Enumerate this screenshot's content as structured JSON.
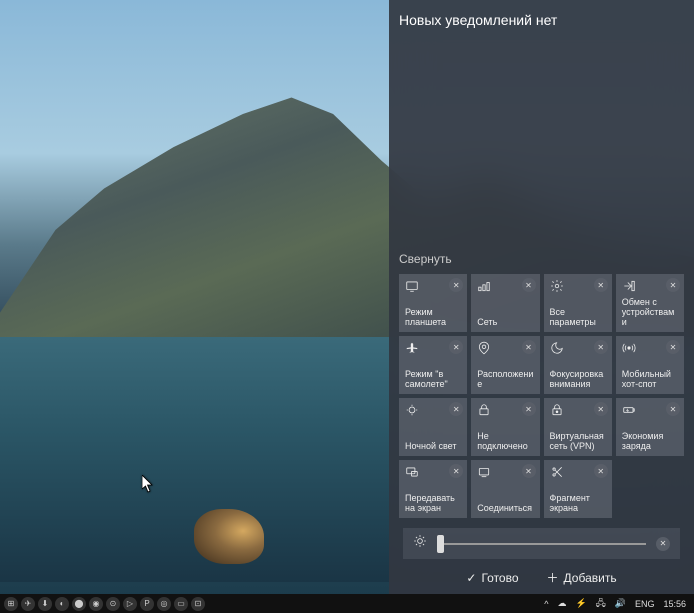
{
  "panel": {
    "title": "Новых уведомлений нет",
    "collapse": "Свернуть",
    "done": "Готово",
    "add": "Добавить"
  },
  "tiles": [
    {
      "icon": "tablet",
      "label": "Режим планшета"
    },
    {
      "icon": "network",
      "label": "Сеть"
    },
    {
      "icon": "settings",
      "label": "Все параметры"
    },
    {
      "icon": "share",
      "label": "Обмен с устройствами"
    },
    {
      "icon": "airplane",
      "label": "Режим \"в самолете\""
    },
    {
      "icon": "location",
      "label": "Расположение"
    },
    {
      "icon": "moon",
      "label": "Фокусировка внимания"
    },
    {
      "icon": "hotspot",
      "label": "Мобильный хот-спот"
    },
    {
      "icon": "nightlight",
      "label": "Ночной свет"
    },
    {
      "icon": "vpn-off",
      "label": "Не подключено"
    },
    {
      "icon": "vpn",
      "label": "Виртуальная сеть (VPN)"
    },
    {
      "icon": "battery",
      "label": "Экономия заряда"
    },
    {
      "icon": "project",
      "label": "Передавать на экран"
    },
    {
      "icon": "connect",
      "label": "Соединиться"
    },
    {
      "icon": "snip",
      "label": "Фрагмент экрана"
    }
  ],
  "brightness": {
    "icon": "sun"
  },
  "taskbar": {
    "left_icons": [
      "⊞",
      "✈",
      "⬇",
      "◐",
      "⬤",
      "◉",
      "⊙",
      "▷",
      "P",
      "◎",
      "▭",
      "⊡"
    ],
    "tray": {
      "chevron": "^",
      "cloud": "☁",
      "power": "⚡",
      "net": "🖧",
      "vol": "🔊"
    },
    "lang": "ENG",
    "time": "15:56"
  }
}
